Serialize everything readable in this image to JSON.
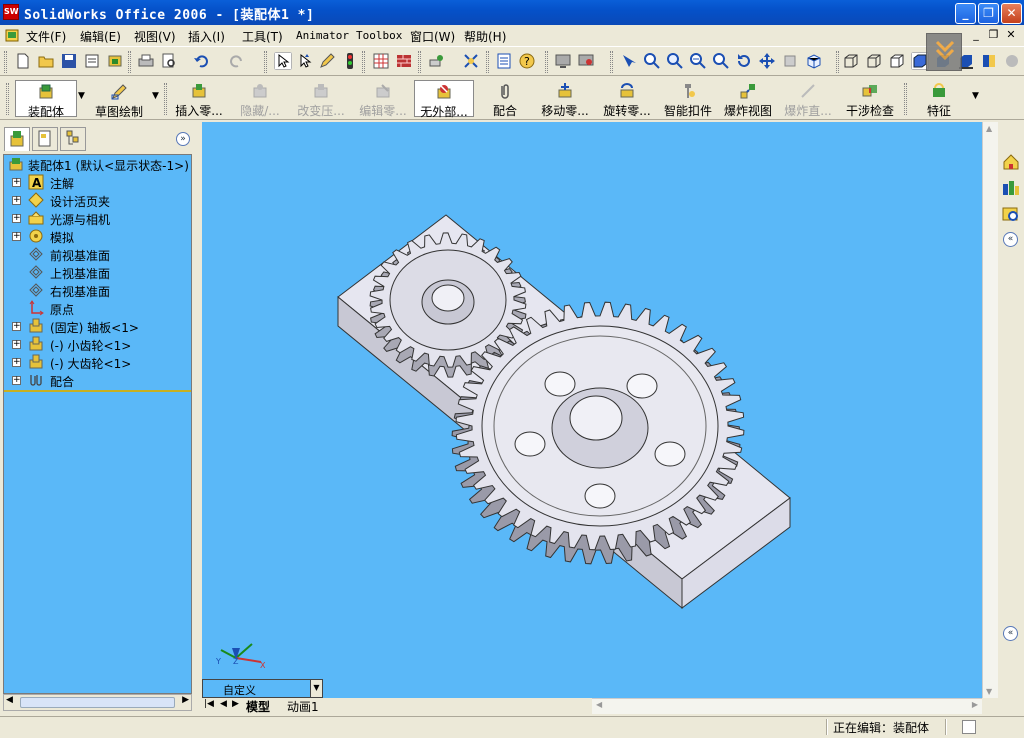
{
  "window": {
    "title": "SolidWorks Office 2006 - [装配体1 *]",
    "app_icon_text": "SW",
    "minimize_symbol": "_",
    "restore_symbol": "❐",
    "close_symbol": "✕"
  },
  "menu": {
    "items": [
      "文件(F)",
      "编辑(E)",
      "视图(V)",
      "插入(I)",
      "工具(T)",
      "Animator",
      "Toolbox",
      "窗口(W)",
      "帮助(H)"
    ],
    "doc_controls": [
      "_",
      "❐",
      "✕"
    ]
  },
  "command_manager": {
    "tabs": [
      "装配体",
      "草图绘制"
    ],
    "buttons": [
      {
        "label": "插入零...",
        "enabled": true
      },
      {
        "label": "隐藏/...",
        "enabled": false
      },
      {
        "label": "改变压...",
        "enabled": false
      },
      {
        "label": "编辑零...",
        "enabled": false
      },
      {
        "label": "无外部...",
        "enabled": true,
        "pressed": true
      },
      {
        "label": "配合",
        "enabled": true
      },
      {
        "label": "移动零...",
        "enabled": true
      },
      {
        "label": "旋转零...",
        "enabled": true
      },
      {
        "label": "智能扣件",
        "enabled": true
      },
      {
        "label": "爆炸视图",
        "enabled": true
      },
      {
        "label": "爆炸直...",
        "enabled": false
      },
      {
        "label": "干涉检查",
        "enabled": true
      },
      {
        "label": "特征",
        "enabled": true
      }
    ]
  },
  "feature_tree": {
    "root": "装配体1  (默认<显示状态-1>)",
    "items": [
      {
        "label": "注解",
        "icon": "annotation-icon",
        "expandable": true
      },
      {
        "label": "设计活页夹",
        "icon": "design-binder-icon",
        "expandable": true
      },
      {
        "label": "光源与相机",
        "icon": "lights-camera-icon",
        "expandable": true
      },
      {
        "label": "模拟",
        "icon": "simulation-icon",
        "expandable": true
      },
      {
        "label": "前视基准面",
        "icon": "plane-icon",
        "expandable": false
      },
      {
        "label": "上视基准面",
        "icon": "plane-icon",
        "expandable": false
      },
      {
        "label": "右视基准面",
        "icon": "plane-icon",
        "expandable": false
      },
      {
        "label": "原点",
        "icon": "origin-icon",
        "expandable": false
      },
      {
        "label": "(固定) 轴板<1>",
        "icon": "part-icon",
        "expandable": true
      },
      {
        "label": "(-) 小齿轮<1>",
        "icon": "part-icon",
        "expandable": true
      },
      {
        "label": "(-) 大齿轮<1>",
        "icon": "part-icon",
        "expandable": true
      },
      {
        "label": "配合",
        "icon": "mates-icon",
        "expandable": true
      }
    ]
  },
  "graphics": {
    "background_color": "#5ab8f8",
    "view_orientation": "自定义",
    "triad_labels": [
      "X",
      "Y",
      "Z"
    ]
  },
  "bottom_tabs": [
    "模型",
    "动画1"
  ],
  "status": {
    "text": "正在编辑：装配体"
  }
}
